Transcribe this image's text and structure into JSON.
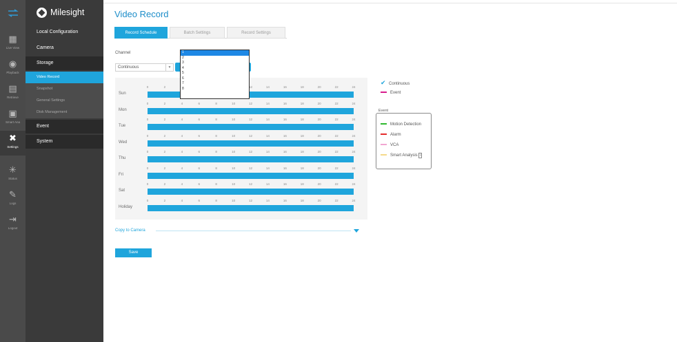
{
  "brand": {
    "name": "Milesight"
  },
  "rail": [
    {
      "icon": "transfer-icon",
      "label": ""
    },
    {
      "icon": "live-view-icon",
      "label": "Live View"
    },
    {
      "icon": "playback-icon",
      "label": "Playback"
    },
    {
      "icon": "retrieve-icon",
      "label": "Retrieve"
    },
    {
      "icon": "smart-analysis-icon",
      "label": "Smart Ana"
    },
    {
      "icon": "settings-icon",
      "label": "Settings"
    },
    {
      "icon": "status-icon",
      "label": "Status"
    },
    {
      "icon": "logs-icon",
      "label": "Logs"
    },
    {
      "icon": "logout-icon",
      "label": "Logout"
    }
  ],
  "nav": {
    "local_configuration": "Local Configuration",
    "camera": "Camera",
    "storage": "Storage",
    "storage_items": [
      "Video Record",
      "Snapshot",
      "General Settings",
      "Disk Management"
    ],
    "event": "Event",
    "system": "System"
  },
  "page": {
    "title": "Video Record"
  },
  "tabs": [
    "Record Schedule",
    "Batch Settings",
    "Record Settings"
  ],
  "channel_label": "Channel",
  "record_type": "Continuous",
  "channel_options": [
    "1",
    "2",
    "3",
    "4",
    "5",
    "6",
    "7",
    "8"
  ],
  "schedule": {
    "days": [
      "Sun",
      "Mon",
      "Tue",
      "Wed",
      "Thu",
      "Fri",
      "Sat",
      "Holiday"
    ],
    "hours": [
      "0",
      "2",
      "4",
      "6",
      "8",
      "10",
      "12",
      "14",
      "16",
      "18",
      "20",
      "22",
      "24"
    ]
  },
  "legend": {
    "continuous": "Continuous",
    "event": "Event"
  },
  "event_legend": {
    "title": "Event",
    "items": [
      "Motion Detection",
      "Alarm",
      "VCA",
      "Smart Analysis"
    ]
  },
  "copy_label": "Copy to Camera",
  "save_label": "Save",
  "colors": {
    "accent": "#1fa5dc",
    "motion": "#2eb82e",
    "alarm": "#e52a2a",
    "vca": "#f2a6d2",
    "smart": "#f5d98a",
    "event": "#d81b8c"
  }
}
